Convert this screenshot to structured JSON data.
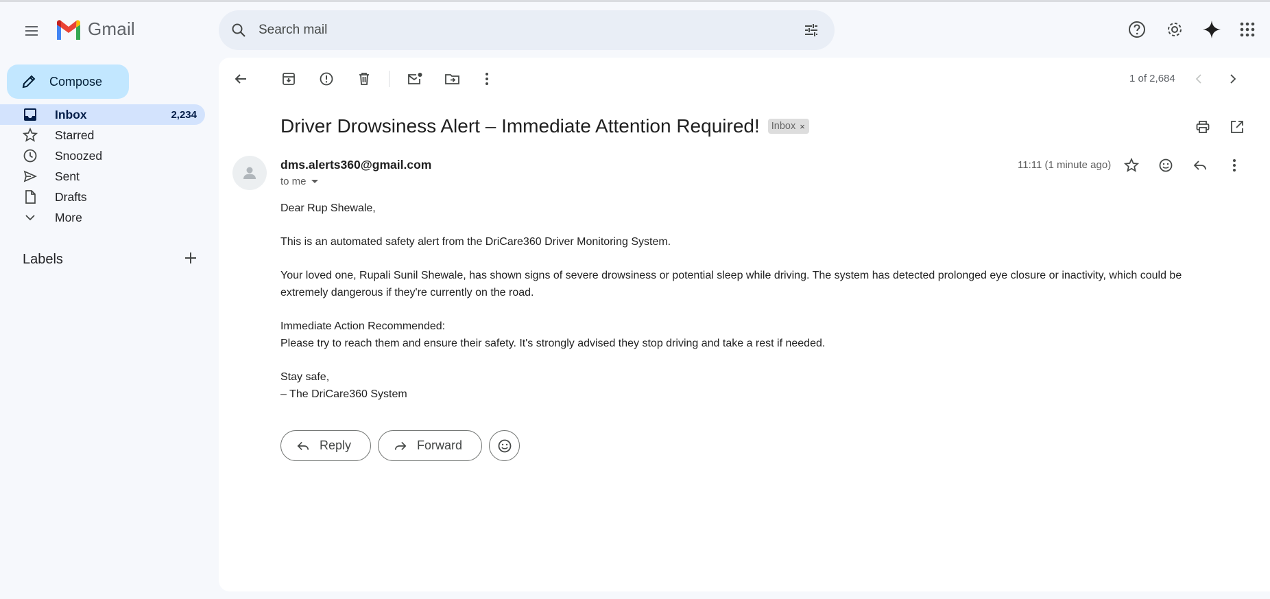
{
  "header": {
    "app_name": "Gmail",
    "search_placeholder": "Search mail"
  },
  "sidebar": {
    "compose_label": "Compose",
    "items": [
      {
        "label": "Inbox",
        "count": "2,234",
        "icon": "inbox-icon"
      },
      {
        "label": "Starred",
        "count": "",
        "icon": "star-icon"
      },
      {
        "label": "Snoozed",
        "count": "",
        "icon": "clock-icon"
      },
      {
        "label": "Sent",
        "count": "",
        "icon": "send-icon"
      },
      {
        "label": "Drafts",
        "count": "",
        "icon": "draft-icon"
      },
      {
        "label": "More",
        "count": "",
        "icon": "chevron-down-icon"
      }
    ],
    "labels_heading": "Labels"
  },
  "toolbar": {
    "pager": "1 of 2,684"
  },
  "email": {
    "subject": "Driver Drowsiness Alert – Immediate Attention Required!",
    "label_chip": "Inbox",
    "label_chip_close": "×",
    "sender": "dms.alerts360@gmail.com",
    "recipient": "to me",
    "time": "11:11 (1 minute ago)",
    "body": {
      "greeting": "Dear Rup Shewale,",
      "p1": "This is an automated safety alert from the DriCare360 Driver Monitoring System.",
      "p2": "Your loved one, Rupali Sunil Shewale, has shown signs of severe drowsiness or potential sleep while driving. The system has detected prolonged eye closure or inactivity, which could be extremely dangerous if they're currently on the road.",
      "p3_heading": "Immediate Action Recommended:",
      "p3": "Please try to reach them and ensure their safety. It's strongly advised they stop driving and take a rest if needed.",
      "signoff": "Stay safe,",
      "signature": "– The DriCare360 System"
    },
    "reply_label": "Reply",
    "forward_label": "Forward"
  },
  "colors": {
    "background": "#f6f8fc",
    "compose": "#c2e7ff",
    "active_nav": "#d3e3fd",
    "search": "#e9eef6"
  }
}
